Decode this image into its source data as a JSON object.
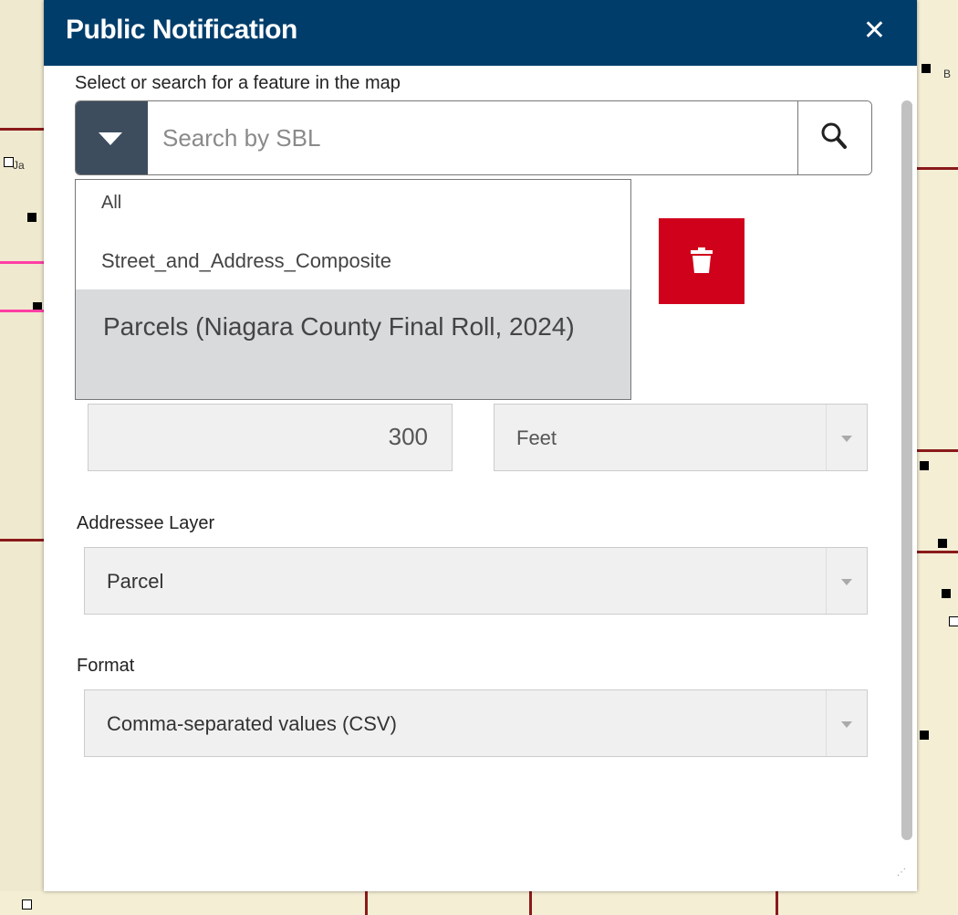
{
  "panel": {
    "title": "Public Notification",
    "close_label": "✕"
  },
  "search": {
    "prompt": "Select or search for a feature in the map",
    "placeholder": "Search by SBL"
  },
  "source_dropdown": {
    "options": [
      "All",
      "Street_and_Address_Composite",
      "Parcels (Niagara County Final Roll, 2024)"
    ],
    "highlighted_index": 2
  },
  "buffer": {
    "distance": "300",
    "unit": "Feet"
  },
  "addressee": {
    "label": "Addressee Layer",
    "value": "Parcel"
  },
  "format": {
    "label": "Format",
    "value": "Comma-separated values (CSV)"
  },
  "map": {
    "labels": [
      "Ja",
      "B"
    ]
  },
  "colors": {
    "header_bg": "#003d6b",
    "delete_button": "#d0021b",
    "annotation_arrow": "#ff3fa4",
    "highlight_row": "#d8dadc"
  },
  "icons": {
    "search": "magnifier-icon",
    "delete": "trash-icon",
    "toggle": "caret-down-icon"
  }
}
